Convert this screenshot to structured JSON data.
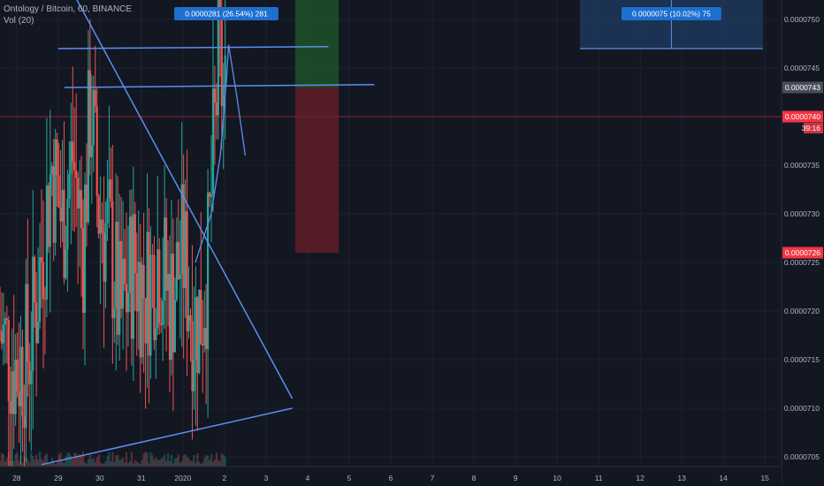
{
  "header": {
    "symbol_line": "Ontology / Bitcoin, 60, BINANCE",
    "indicator_line": "Vol (20)"
  },
  "colors": {
    "background": "#131722",
    "grid": "#1e2230",
    "up_candle": "#26a69a",
    "down_candle": "#ef5350",
    "drawing_line": "#5b8ff0",
    "short_target_fill": "#1f5a28",
    "short_stop_fill": "#6b1f27",
    "measure_fill": "#1e3a5f",
    "label_bg": "#1e6fcf",
    "current_price_bg": "#f23645",
    "marker_price_bg": "#4a4e58",
    "axis_text": "#b2b5be"
  },
  "chart_data": {
    "type": "candlestick",
    "title": "Ontology / Bitcoin, 60, BINANCE",
    "x_ticks": [
      "28",
      "29",
      "30",
      "31",
      "2020",
      "2",
      "3",
      "4",
      "5",
      "6",
      "7",
      "8",
      "9",
      "10",
      "11",
      "12",
      "13",
      "14",
      "15"
    ],
    "x_tick_days": [
      28,
      29,
      30,
      31,
      32,
      33,
      34,
      35,
      36,
      37,
      38,
      39,
      40,
      41,
      42,
      43,
      44,
      45,
      46
    ],
    "x_range_days": [
      27.6,
      46.4
    ],
    "y_ticks": [
      "0.0000750",
      "0.0000745",
      "0.0000735",
      "0.0000730",
      "0.0000725",
      "0.0000720",
      "0.0000715",
      "0.0000710",
      "0.0000705"
    ],
    "y_tick_values": [
      7.5e-05,
      7.45e-05,
      7.35e-05,
      7.3e-05,
      7.25e-05,
      7.2e-05,
      7.15e-05,
      7.1e-05,
      7.05e-05
    ],
    "y_range": [
      7.04e-05,
      7.52e-05
    ],
    "grid": true,
    "price_markers": [
      {
        "label": "0.0000743",
        "value": 7.43e-05,
        "kind": "marker"
      },
      {
        "label": "0.0000740",
        "value": 7.4e-05,
        "kind": "current",
        "countdown": "39:16"
      },
      {
        "label": "0.0000726",
        "value": 7.26e-05,
        "kind": "stop"
      }
    ],
    "candle_anchors": [
      {
        "day": 27.6,
        "price": 7.18e-05
      },
      {
        "day": 28.0,
        "price": 7.14e-05
      },
      {
        "day": 28.3,
        "price": 7.16e-05
      },
      {
        "day": 28.5,
        "price": 7.22e-05
      },
      {
        "day": 28.85,
        "price": 7.35e-05
      },
      {
        "day": 29.1,
        "price": 7.29e-05
      },
      {
        "day": 29.35,
        "price": 7.36e-05
      },
      {
        "day": 29.6,
        "price": 7.27e-05
      },
      {
        "day": 29.78,
        "price": 7.42e-05
      },
      {
        "day": 29.95,
        "price": 7.31e-05
      },
      {
        "day": 30.25,
        "price": 7.27e-05
      },
      {
        "day": 30.5,
        "price": 7.19e-05
      },
      {
        "day": 30.8,
        "price": 7.25e-05
      },
      {
        "day": 31.1,
        "price": 7.22e-05
      },
      {
        "day": 31.4,
        "price": 7.26e-05
      },
      {
        "day": 31.7,
        "price": 7.21e-05
      },
      {
        "day": 32.0,
        "price": 7.26e-05
      },
      {
        "day": 32.25,
        "price": 7.19e-05
      },
      {
        "day": 32.45,
        "price": 7.2e-05
      },
      {
        "day": 32.6,
        "price": 7.25e-05
      },
      {
        "day": 32.72,
        "price": 7.35e-05
      },
      {
        "day": 32.86,
        "price": 7.46e-05
      },
      {
        "day": 32.98,
        "price": 7.42e-05
      },
      {
        "day": 33.05,
        "price": 7.4e-05
      }
    ],
    "drawings": {
      "horizontal_line_upper": {
        "start": {
          "day": 29.0,
          "price": 7.47e-05
        },
        "end": {
          "day": 35.5,
          "price": 7.472e-05
        }
      },
      "horizontal_line_lower": {
        "start": {
          "day": 29.15,
          "price": 7.43e-05
        },
        "end": {
          "day": 36.6,
          "price": 7.433e-05
        }
      },
      "triangle_upper_side": {
        "start": {
          "day": 29.2,
          "price": 7.54e-05
        },
        "end": {
          "day": 34.63,
          "price": 7.11e-05
        }
      },
      "triangle_lower_side": {
        "start": {
          "day": 28.6,
          "price": 7.042e-05
        },
        "end": {
          "day": 34.63,
          "price": 7.1e-05
        }
      },
      "curve": [
        {
          "day": 32.3,
          "price": 7.25e-05
        },
        {
          "day": 32.68,
          "price": 7.3e-05
        },
        {
          "day": 32.9,
          "price": 7.36e-05
        },
        {
          "day": 33.05,
          "price": 7.44e-05
        },
        {
          "day": 33.1,
          "price": 7.474e-05
        },
        {
          "day": 33.3,
          "price": 7.42e-05
        },
        {
          "day": 33.5,
          "price": 7.36e-05
        }
      ]
    },
    "short_position": {
      "start_day": 34.7,
      "end_day": 35.75,
      "entry": 7.43e-05,
      "target": 7.52e-05,
      "stop": 7.26e-05,
      "label": "0.0000281 (26.54%) 281"
    },
    "measure": {
      "start_day": 41.55,
      "end_day": 45.95,
      "top": 7.52e-05,
      "bottom": 7.47e-05,
      "label": "0.0000075 (10.02%) 75"
    }
  }
}
